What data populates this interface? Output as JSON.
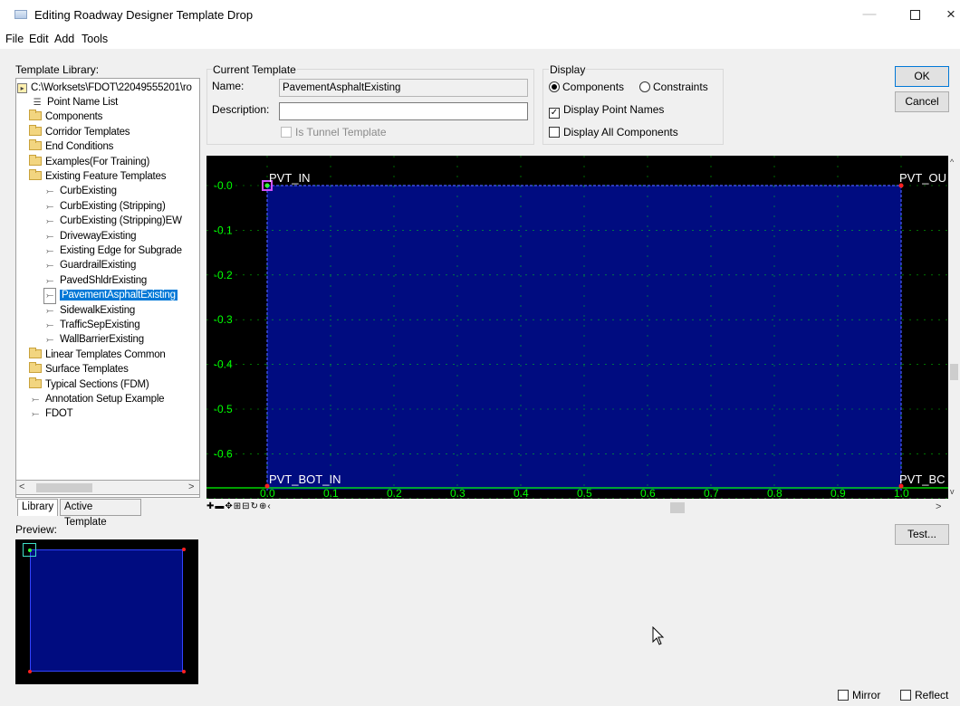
{
  "window": {
    "title": "Editing Roadway Designer Template Drop",
    "minimize": "—",
    "close": "×"
  },
  "menu": [
    "File",
    "Edit",
    "Add",
    "Tools"
  ],
  "library": {
    "label": "Template Library:",
    "root": "C:\\Worksets\\FDOT\\22049555201\\ro",
    "items": [
      {
        "label": "Point Name List",
        "icon": "list-icon"
      },
      {
        "label": "Components",
        "icon": "folder-icon"
      },
      {
        "label": "Corridor Templates",
        "icon": "folder-icon"
      },
      {
        "label": "End Conditions",
        "icon": "folder-icon"
      },
      {
        "label": "Examples(For Training)",
        "icon": "folder-icon"
      },
      {
        "label": "Existing Feature Templates",
        "icon": "open-folder-icon"
      },
      {
        "label": "CurbExisting",
        "icon": "template-icon"
      },
      {
        "label": "CurbExisting (Stripping)",
        "icon": "template-icon"
      },
      {
        "label": "CurbExisting (Stripping)EW",
        "icon": "template-icon"
      },
      {
        "label": "DrivewayExisting",
        "icon": "template-icon"
      },
      {
        "label": "Existing Edge for Subgrade",
        "icon": "template-icon"
      },
      {
        "label": "GuardrailExisting",
        "icon": "template-icon"
      },
      {
        "label": "PavedShldrExisting",
        "icon": "template-icon"
      },
      {
        "label": "PavementAsphaltExisting",
        "icon": "template-icon"
      },
      {
        "label": "SidewalkExisting",
        "icon": "template-icon"
      },
      {
        "label": "TrafficSepExisting",
        "icon": "template-icon"
      },
      {
        "label": "WallBarrierExisting",
        "icon": "template-icon"
      },
      {
        "label": "Linear Templates Common",
        "icon": "folder-icon"
      },
      {
        "label": "Surface Templates",
        "icon": "folder-icon"
      },
      {
        "label": "Typical Sections (FDM)",
        "icon": "folder-icon"
      },
      {
        "label": "Annotation Setup Example",
        "icon": "template-icon"
      },
      {
        "label": "FDOT",
        "icon": "template-icon"
      }
    ],
    "selected": "PavementAsphaltExisting",
    "tabs": [
      "Library",
      "Active Template"
    ],
    "active_tab": "Library"
  },
  "preview": {
    "label": "Preview:"
  },
  "current_template": {
    "group_label": "Current Template",
    "name_label": "Name:",
    "name_value": "PavementAsphaltExisting",
    "description_label": "Description:",
    "description_value": "",
    "tunnel_label": "Is Tunnel Template",
    "tunnel_checked": false
  },
  "display": {
    "group_label": "Display",
    "components_label": "Components",
    "constraints_label": "Constraints",
    "selected_mode": "Components",
    "point_names_label": "Display Point Names",
    "point_names_checked": true,
    "all_components_label": "Display All Components",
    "all_components_checked": false
  },
  "buttons": {
    "ok": "OK",
    "cancel": "Cancel",
    "test": "Test..."
  },
  "bottom": {
    "mirror": "Mirror",
    "reflect": "Reflect",
    "mirror_checked": false,
    "reflect_checked": false
  },
  "canvas": {
    "background": "#000000",
    "component_fill": "#000c80",
    "grid_color": "#00ff00",
    "point_names": [
      "PVT_IN",
      "PVT_OU",
      "PVT_BOT_IN",
      "PVT_BC"
    ],
    "x_ticks": [
      "0.0",
      "0.1",
      "0.2",
      "0.3",
      "0.4",
      "0.5",
      "0.6",
      "0.7",
      "0.8",
      "0.9",
      "1.0"
    ],
    "y_ticks": [
      "-0.0",
      "-0.1",
      "-0.2",
      "-0.3",
      "-0.4",
      "-0.5",
      "-0.6"
    ]
  }
}
